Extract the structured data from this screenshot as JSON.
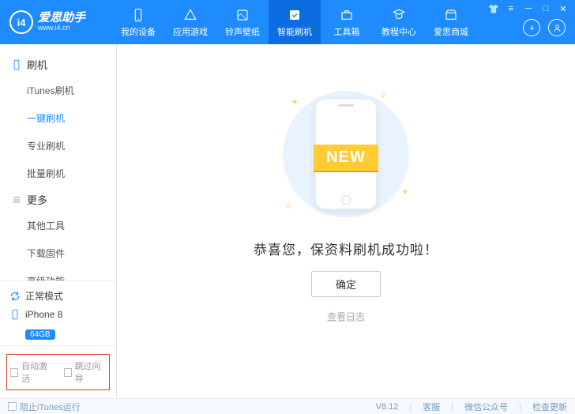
{
  "logo": {
    "mark": "i4",
    "title": "爱思助手",
    "url": "www.i4.cn"
  },
  "nav": [
    {
      "label": "我的设备"
    },
    {
      "label": "应用游戏"
    },
    {
      "label": "铃声壁纸"
    },
    {
      "label": "智能刷机"
    },
    {
      "label": "工具箱"
    },
    {
      "label": "教程中心"
    },
    {
      "label": "爱思商城"
    }
  ],
  "sidebar": {
    "group1": {
      "title": "刷机",
      "items": [
        "iTunes刷机",
        "一键刷机",
        "专业刷机",
        "批量刷机"
      ]
    },
    "group2": {
      "title": "更多",
      "items": [
        "其他工具",
        "下载固件",
        "高级功能"
      ]
    },
    "status": {
      "mode": "正常模式",
      "device": "iPhone 8",
      "storage": "64GB"
    },
    "checks": {
      "auto_activate": "自动激活",
      "skip_guide": "跳过向导"
    }
  },
  "main": {
    "ribbon": "NEW",
    "success": "恭喜您，保资料刷机成功啦！",
    "confirm": "确定",
    "log": "查看日志"
  },
  "footer": {
    "block_itunes": "阻止iTunes运行",
    "version": "V8.12",
    "support": "客服",
    "wechat": "微信公众号",
    "update": "检查更新"
  }
}
